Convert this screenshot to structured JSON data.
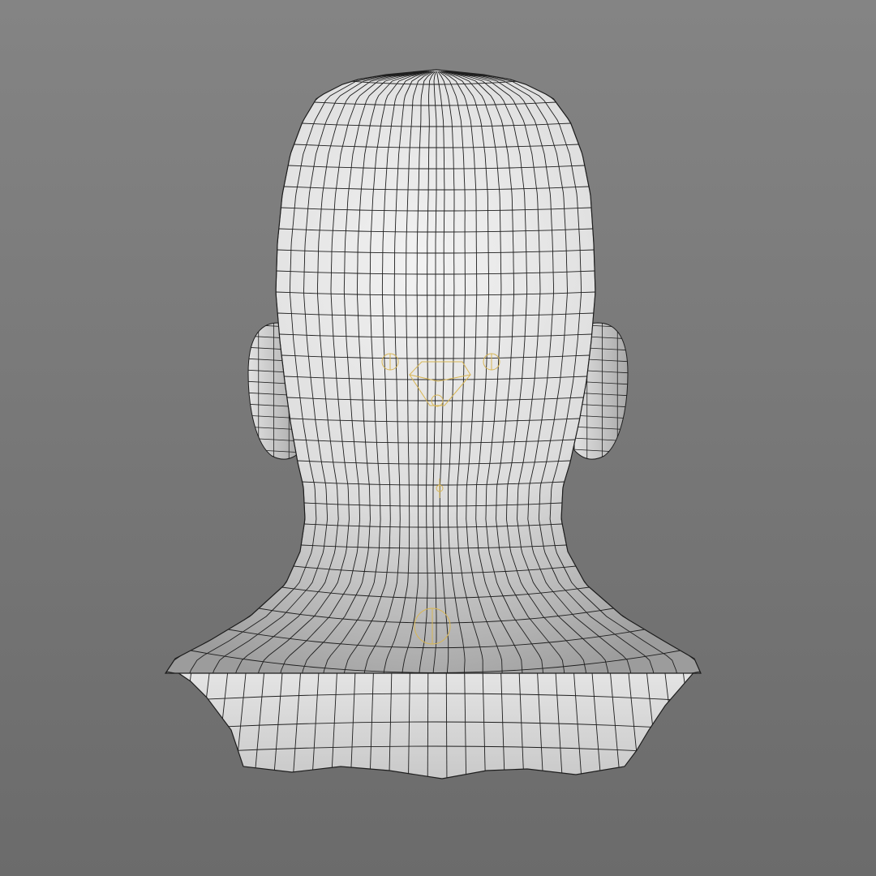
{
  "viewport": {
    "background_top": "#848484",
    "background_bottom": "#6b6b6b",
    "view": "back",
    "display_mode": "wireframe-on-shaded"
  },
  "model": {
    "base_color": "#e4e4e4",
    "shadow_color": "#a9a9a9",
    "wire_color": "#1e1e1e",
    "parts": [
      "head",
      "neck",
      "shoulder-collar",
      "left-ear",
      "right-ear"
    ]
  },
  "rig": {
    "marker_color": "#d8b654",
    "markers": [
      "joint-marker-left",
      "joint-marker-right",
      "joint-marker-center",
      "joint-marker-neck",
      "joint-marker-base"
    ]
  }
}
